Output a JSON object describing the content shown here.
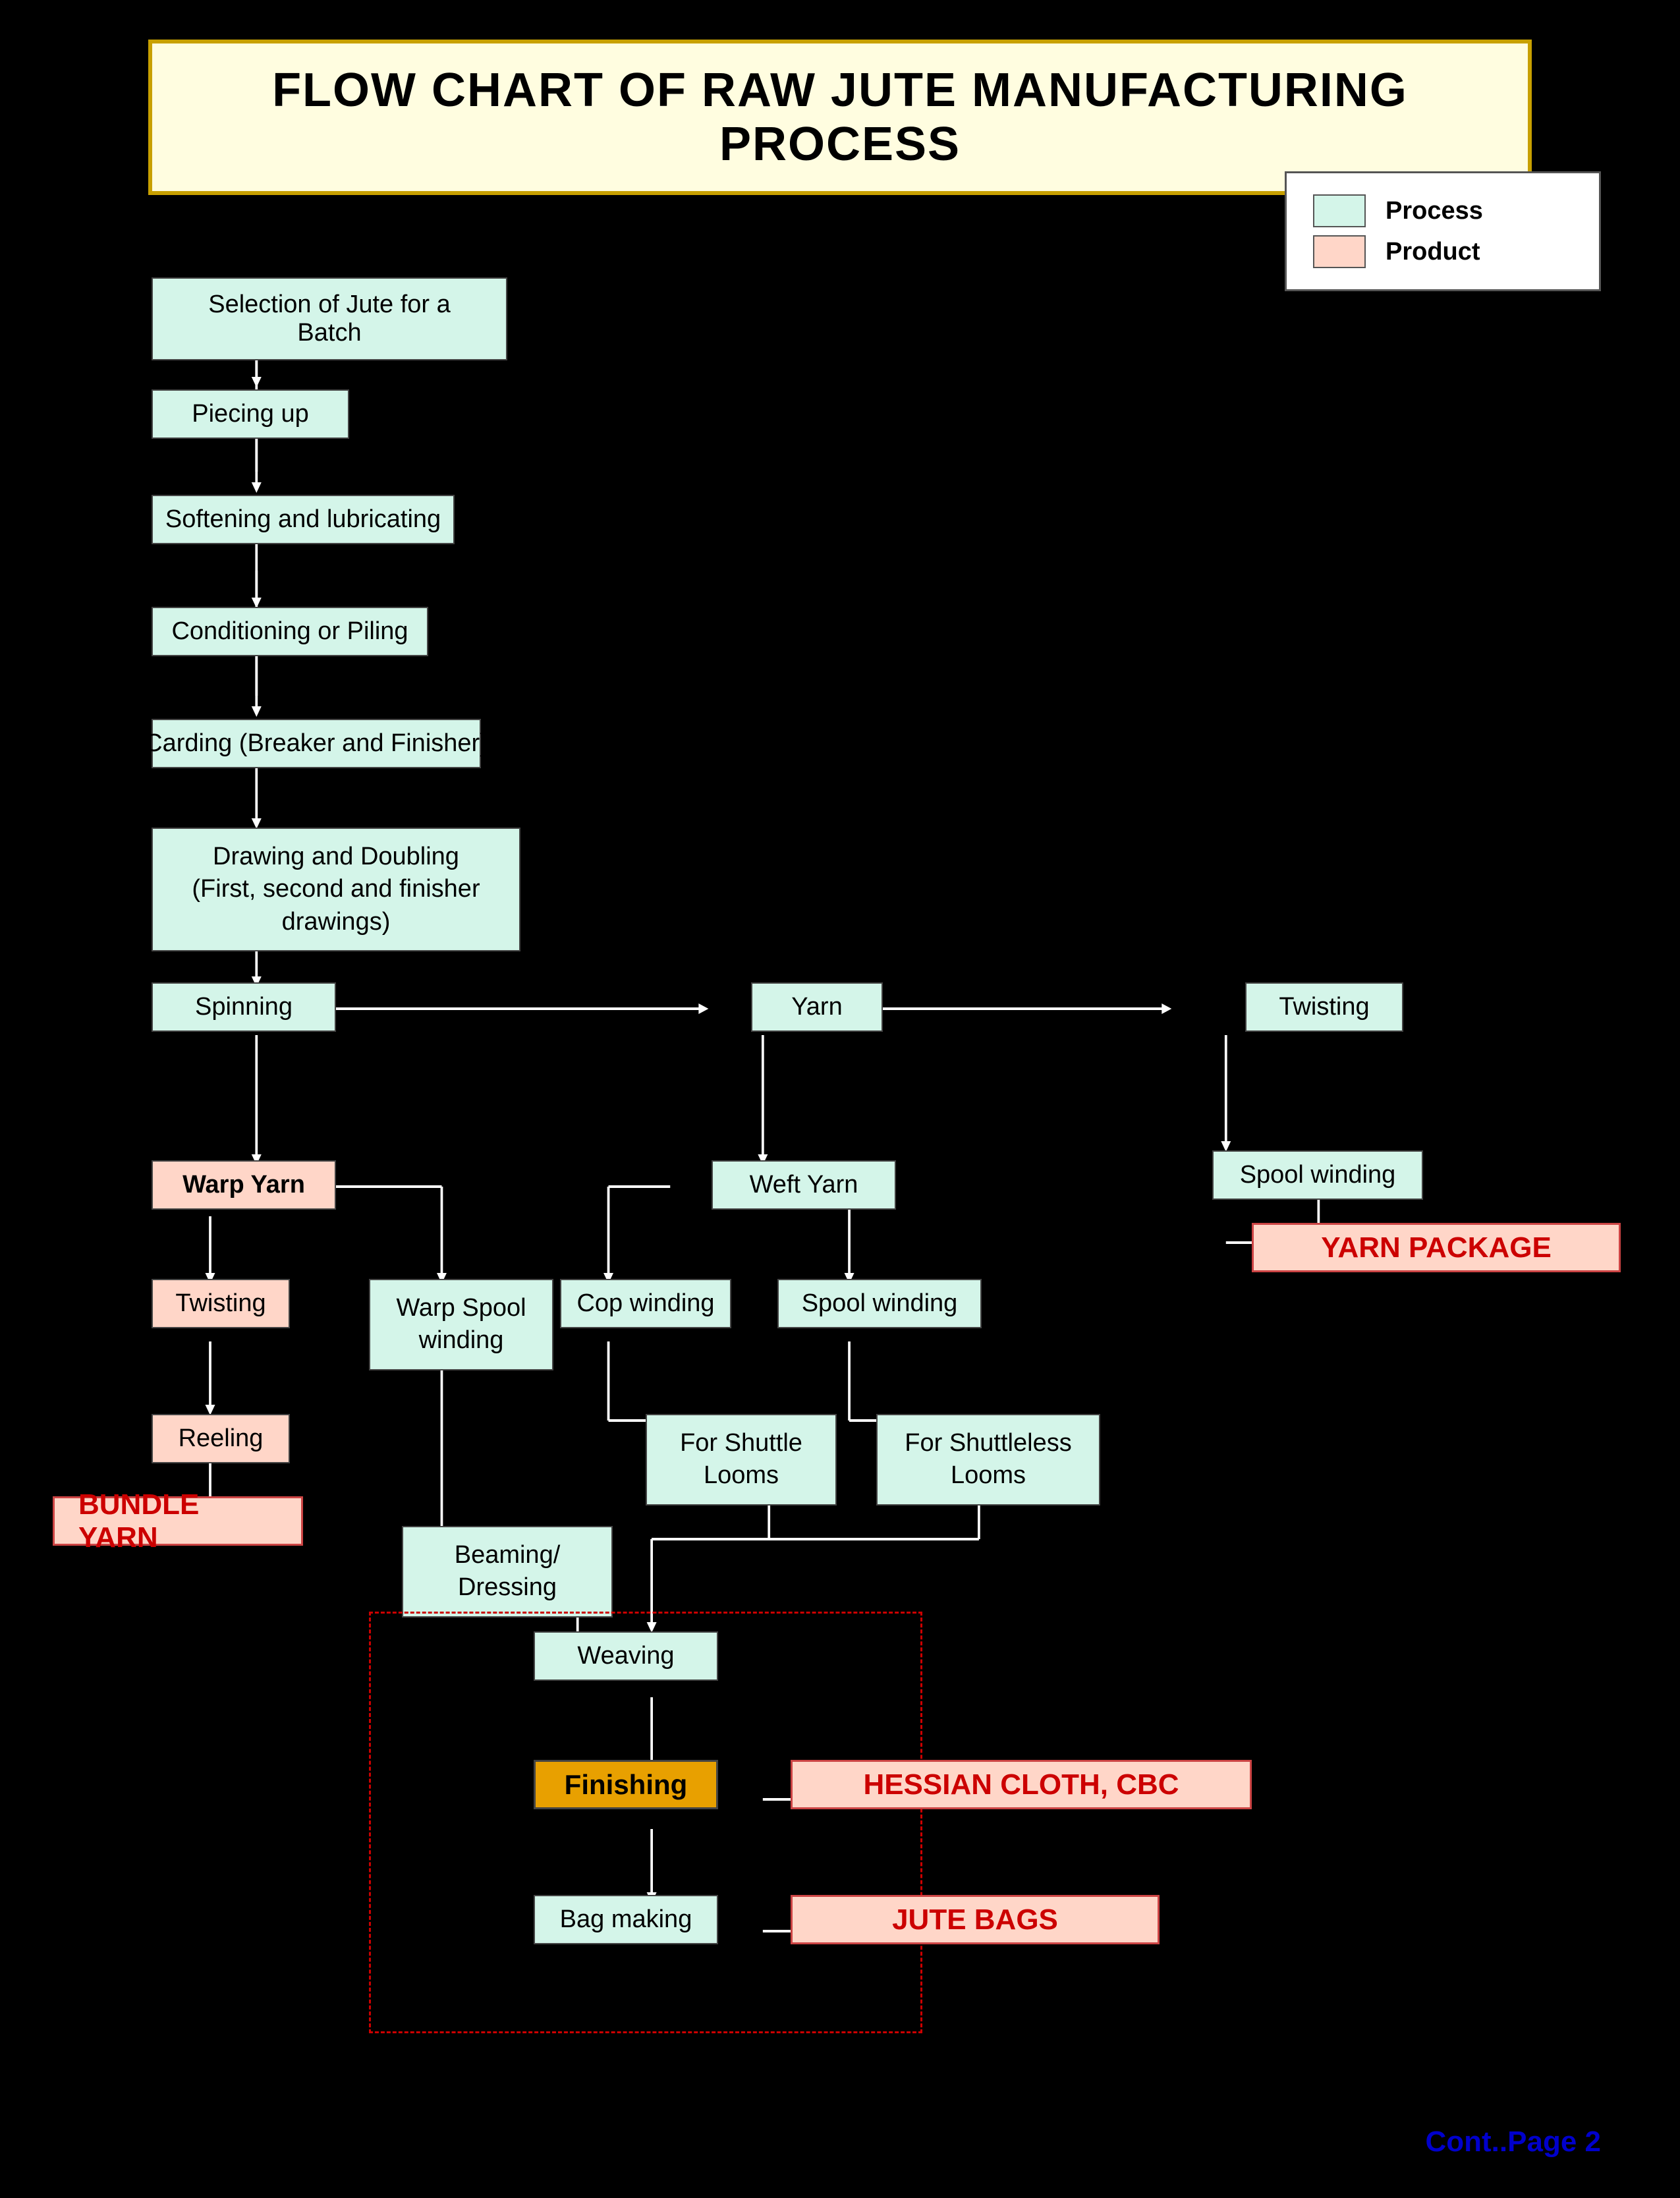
{
  "title": "FLOW CHART OF RAW JUTE MANUFACTURING PROCESS",
  "legend": {
    "process_label": "Process",
    "product_label": "Product"
  },
  "processes": {
    "selection": "Selection of Jute for a Batch",
    "piecing": "Piecing up",
    "softening": "Softening and lubricating",
    "conditioning": "Conditioning or Piling",
    "carding": "Carding (Breaker and Finisher)",
    "drawing": "Drawing and Doubling\n(First, second and finisher drawings)",
    "spinning": "Spinning",
    "yarn": "Yarn",
    "twisting": "Twisting",
    "warp_yarn": "Warp Yarn",
    "weft_yarn": "Weft Yarn",
    "spool_winding_top": "Spool winding",
    "twisting2": "Twisting",
    "warp_spool": "Warp Spool\nwinding",
    "cop_winding": "Cop winding",
    "spool_winding2": "Spool winding",
    "reeling": "Reeling",
    "for_shuttle": "For Shuttle\nLooms",
    "for_shuttleless": "For Shuttleless\nLooms",
    "beaming": "Beaming/\nDressing",
    "weaving": "Weaving",
    "finishing": "Finishing",
    "bag_making": "Bag making"
  },
  "products": {
    "yarn_package": "YARN PACKAGE",
    "bundle_yarn": "BUNDLE YARN",
    "hessian": "HESSIAN CLOTH, CBC",
    "jute_bags": "JUTE BAGS"
  },
  "footer": {
    "cont": "Cont..Page 2"
  }
}
